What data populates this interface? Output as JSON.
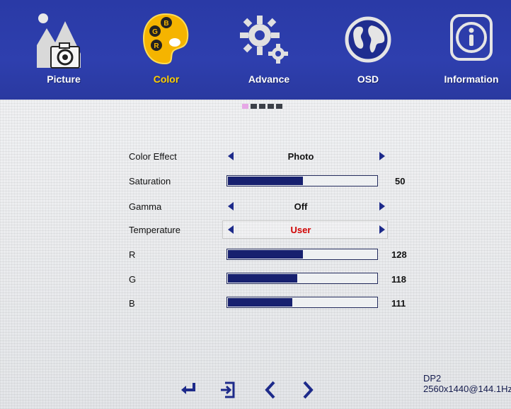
{
  "tabs": [
    {
      "label": "Picture",
      "icon": "picture-icon",
      "active": false
    },
    {
      "label": "Color",
      "icon": "palette-icon",
      "active": true
    },
    {
      "label": "Advance",
      "icon": "gear-icon",
      "active": false
    },
    {
      "label": "OSD",
      "icon": "globe-icon",
      "active": false
    },
    {
      "label": "Information",
      "icon": "info-icon",
      "active": false
    }
  ],
  "palette_letters": [
    "B",
    "G",
    "R"
  ],
  "page_indicator": {
    "count": 5,
    "current": 1
  },
  "settings": {
    "color_effect": {
      "label": "Color Effect",
      "value": "Photo"
    },
    "saturation": {
      "label": "Saturation",
      "value": 50,
      "level": 0.5
    },
    "gamma": {
      "label": "Gamma",
      "value": "Off"
    },
    "temperature": {
      "label": "Temperature",
      "value": "User"
    },
    "r": {
      "label": "R",
      "value": 128,
      "level": 0.5
    },
    "g": {
      "label": "G",
      "value": 118,
      "level": 0.46
    },
    "b": {
      "label": "B",
      "value": 111,
      "level": 0.43
    }
  },
  "footer": {
    "icons": [
      "enter-icon",
      "exit-icon",
      "left-chevron-icon",
      "right-chevron-icon"
    ],
    "input": "DP2",
    "resolution": "2560x1440@144.1Hz"
  },
  "colors": {
    "header": "#2e3fae",
    "active_label": "#ffd000",
    "bar_fill": "#17206f",
    "selected_value": "#d00000"
  }
}
